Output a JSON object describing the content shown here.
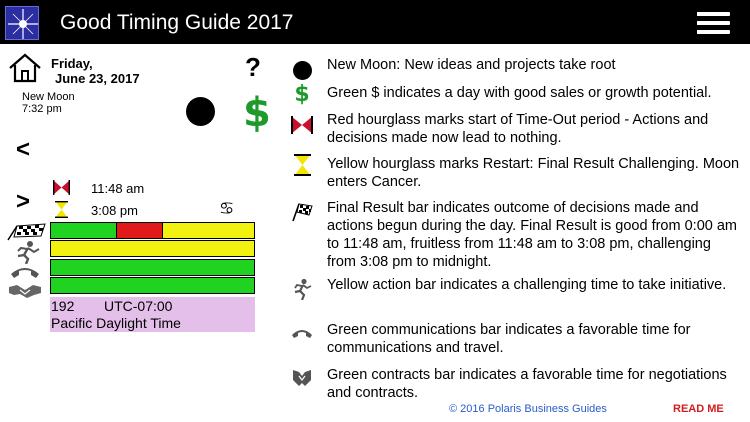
{
  "header": {
    "title": "Good Timing Guide 2017"
  },
  "day": {
    "weekday": "Friday,",
    "date": "June 23, 2017",
    "moon_phase": "New Moon",
    "moon_time": "7:32 pm",
    "help_symbol": "?",
    "dollar_symbol": "$",
    "prev_symbol": "<",
    "next_symbol": ">",
    "restart_time_out": "11:48 am",
    "restart_time": "3:08 pm",
    "moon_sign_glyph": "♋"
  },
  "bars": {
    "final_result": [
      {
        "color": "#21d321",
        "fraction": 0.325
      },
      {
        "color": "#e01a1a",
        "fraction": 0.225
      },
      {
        "color": "#f2f210",
        "fraction": 0.45
      }
    ],
    "action": [
      {
        "color": "#f2f210",
        "fraction": 1
      }
    ],
    "communications": [
      {
        "color": "#21d321",
        "fraction": 1
      }
    ],
    "contracts": [
      {
        "color": "#21d321",
        "fraction": 1
      }
    ]
  },
  "timezone": {
    "number": "192",
    "utc": "UTC-07:00",
    "name": "Pacific Daylight Time"
  },
  "legend": [
    {
      "icon": "new-moon-icon",
      "text": "New Moon: New ideas and projects take root"
    },
    {
      "icon": "dollar-icon",
      "text": "Green $ indicates a day with good sales or growth potential."
    },
    {
      "icon": "red-hourglass-icon",
      "text": "Red hourglass marks start of Time-Out period - Actions and decisions made now lead to nothing."
    },
    {
      "icon": "yellow-hourglass-icon",
      "text": "Yellow hourglass marks Restart: Final Result Challenging. Moon enters Cancer."
    },
    {
      "icon": "checkered-flag-icon",
      "text": "Final Result bar indicates outcome of decisions made and actions begun during the day. Final Result is good from 0:00 am to 11:48 am, fruitless from 11:48 am to 3:08 pm, challenging from 3:08 pm to midnight."
    },
    {
      "icon": "runner-icon",
      "text": "Yellow action bar indicates a challenging time to take initiative."
    },
    {
      "icon": "phone-icon",
      "text": "Green communications bar indicates a favorable time for communications and travel."
    },
    {
      "icon": "handshake-icon",
      "text": "Green contracts bar indicates a favorable time for negotiations and contracts."
    }
  ],
  "colors": {
    "green": "#1e9a2a",
    "red": "#c8102e",
    "yellow": "#f2e600",
    "link": "#2a5cc8",
    "readme": "#d21d1d"
  },
  "footer": {
    "copyright": "© 2016 Polaris Business Guides",
    "readme": "READ ME"
  }
}
